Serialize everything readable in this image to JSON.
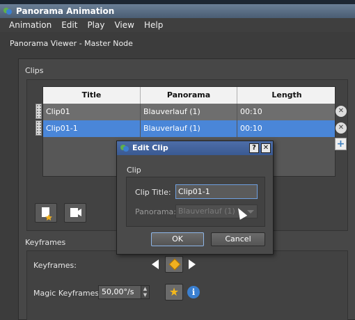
{
  "window": {
    "title": "Panorama Animation"
  },
  "menu": [
    "Animation",
    "Edit",
    "Play",
    "View",
    "Help"
  ],
  "viewer_title": "Panorama Viewer - Master Node",
  "clips": {
    "label": "Clips",
    "columns": [
      "Title",
      "Panorama",
      "Length"
    ],
    "rows": [
      {
        "title": "Clip01",
        "panorama": "Blauverlauf (1)",
        "length": "00:10"
      },
      {
        "title": "Clip01-1",
        "panorama": "Blauverlauf (1)",
        "length": "00:10"
      }
    ]
  },
  "keyframes": {
    "label": "Keyframes",
    "row_label": "Keyframes:",
    "magic_label": "Magic Keyframes:",
    "magic_value": "50,00°/s"
  },
  "dialog": {
    "title": "Edit Clip",
    "help_btn": "?",
    "close_btn": "✕",
    "group_label": "Clip",
    "clip_title_label": "Clip Title:",
    "clip_title_value": "Clip01-1",
    "panorama_label": "Panorama:",
    "panorama_value": "Blauverlauf (1)",
    "ok": "OK",
    "cancel": "Cancel"
  },
  "colors": {
    "selection": "#4a86d8",
    "title_bar": "#4a5d73",
    "keyframe": "#f0b020"
  }
}
